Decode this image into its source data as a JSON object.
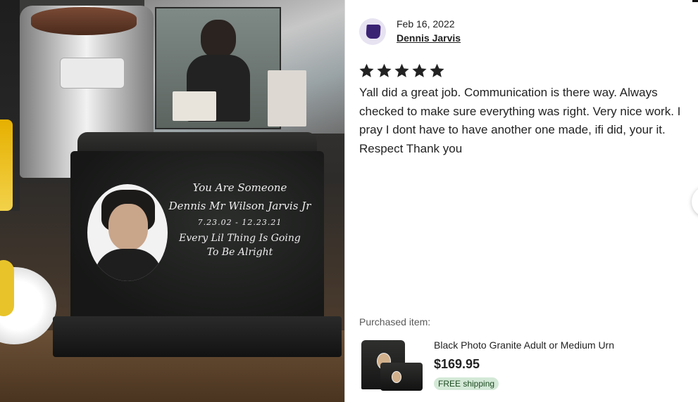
{
  "review": {
    "date": "Feb 16, 2022",
    "reviewer_name": "Dennis Jarvis",
    "rating": 5,
    "rating_max": 5,
    "text": "Yall did a great job. Communication is there way. Always checked to make sure everything was right. Very nice work. I pray I dont have to have another one made, ifi did, your it. Respect Thank you"
  },
  "photo": {
    "engraving": {
      "line1": "You Are Someone",
      "line2": "Dennis Mr Wilson Jarvis Jr",
      "line3": "7.23.02 - 12.23.21",
      "line4": "Every Lil Thing Is Going",
      "line5": "To Be Alright"
    }
  },
  "purchased": {
    "label": "Purchased item:",
    "title": "Black Photo Granite Adult or Medium Urn",
    "price": "$169.95",
    "shipping_badge": "FREE shipping"
  },
  "colors": {
    "star": "#222222",
    "avatar_bg": "#e7e3f1",
    "avatar_shape": "#3b2374",
    "shipping_badge_bg": "#d4e9d7",
    "shipping_badge_text": "#1c4a21"
  },
  "icons": {
    "star": "star-icon",
    "avatar": "user-avatar-icon",
    "next": "chevron-right-icon"
  }
}
